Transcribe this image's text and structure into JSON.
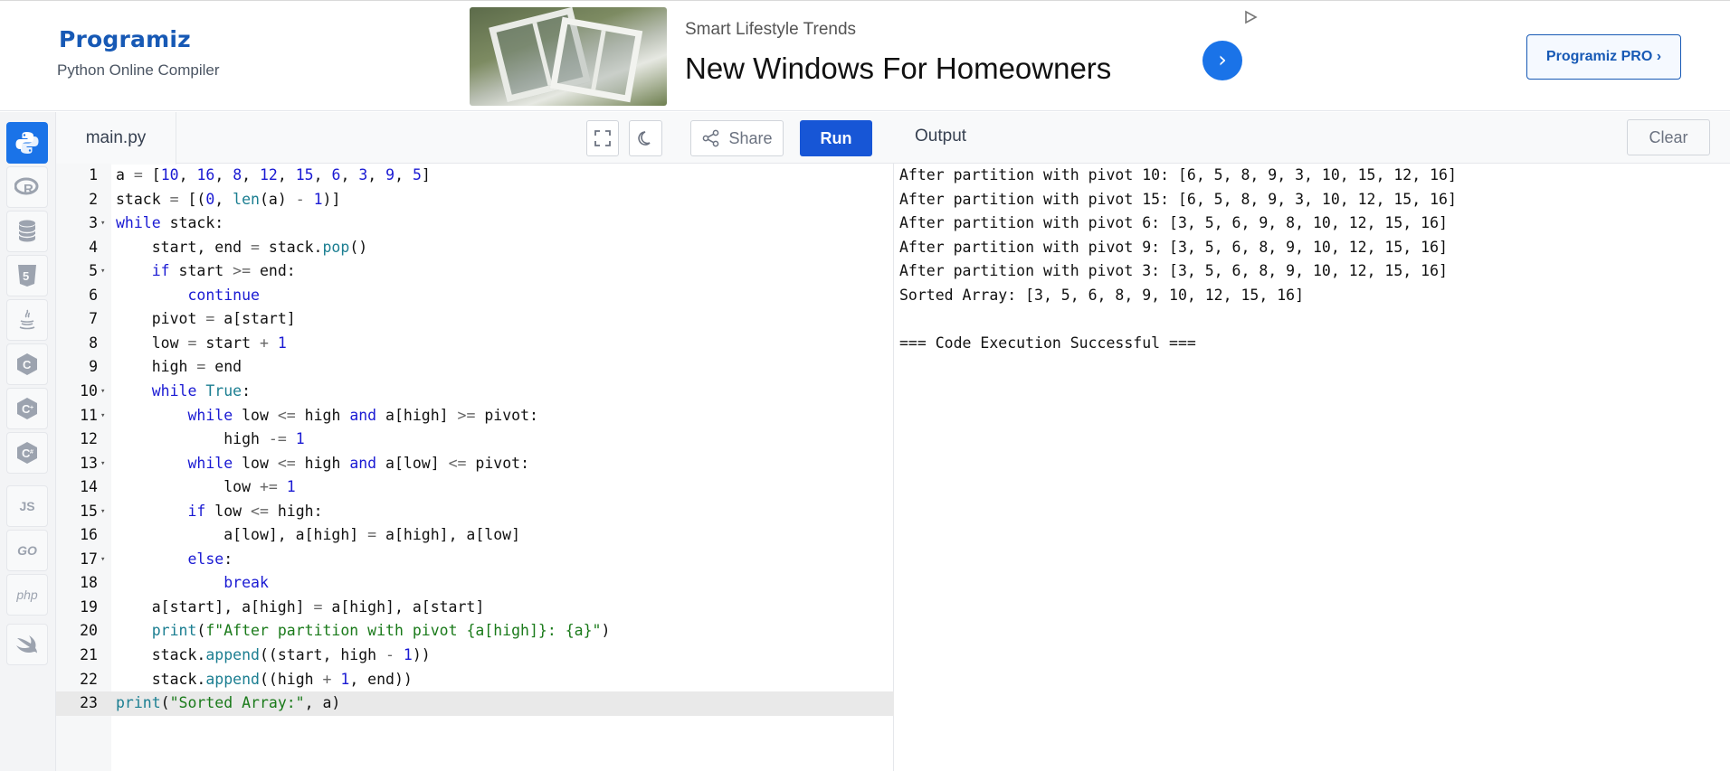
{
  "header": {
    "logo_text": "Programiz",
    "subtitle": "Python Online Compiler",
    "pro_button": "Programiz PRO ›"
  },
  "ad": {
    "brand": "Smart Lifestyle Trends",
    "title": "New Windows For Homeowners",
    "go_icon": "chevron-right-icon",
    "choice_icon": "ad-choices-icon"
  },
  "language_rail": {
    "items": [
      {
        "name": "python",
        "icon": "python-icon",
        "active": true
      },
      {
        "name": "r",
        "icon": "r-icon",
        "active": false
      },
      {
        "name": "sql",
        "icon": "database-icon",
        "active": false
      },
      {
        "name": "html",
        "icon": "html5-icon",
        "active": false
      },
      {
        "name": "java",
        "icon": "java-icon",
        "active": false
      },
      {
        "name": "c",
        "icon": "c-icon",
        "active": false
      },
      {
        "name": "cpp",
        "icon": "cpp-icon",
        "active": false
      },
      {
        "name": "csharp",
        "icon": "csharp-icon",
        "active": false
      },
      {
        "name": "js",
        "label": "JS",
        "active": false
      },
      {
        "name": "go",
        "label": "GO",
        "active": false
      },
      {
        "name": "php",
        "label": "php",
        "active": false
      },
      {
        "name": "swift",
        "icon": "swift-icon",
        "active": false
      }
    ]
  },
  "editor": {
    "file_tab": "main.py",
    "share_label": "Share",
    "run_label": "Run",
    "active_line": 23,
    "lines": [
      "a = [10, 16, 8, 12, 15, 6, 3, 9, 5]",
      "stack = [(0, len(a) - 1)]",
      "while stack:",
      "    start, end = stack.pop()",
      "    if start >= end:",
      "        continue",
      "    pivot = a[start]",
      "    low = start + 1",
      "    high = end",
      "    while True:",
      "        while low <= high and a[high] >= pivot:",
      "            high -= 1",
      "        while low <= high and a[low] <= pivot:",
      "            low += 1",
      "        if low <= high:",
      "            a[low], a[high] = a[high], a[low]",
      "        else:",
      "            break",
      "    a[start], a[high] = a[high], a[start]",
      "    print(f\"After partition with pivot {a[high]}: {a}\")",
      "    stack.append((start, high - 1))",
      "    stack.append((high + 1, end))",
      "print(\"Sorted Array:\", a)"
    ],
    "fold_lines": [
      3,
      5,
      10,
      11,
      13,
      15,
      17
    ]
  },
  "output": {
    "title": "Output",
    "clear_label": "Clear",
    "lines": [
      "After partition with pivot 10: [6, 5, 8, 9, 3, 10, 15, 12, 16]",
      "After partition with pivot 15: [6, 5, 8, 9, 3, 10, 12, 15, 16]",
      "After partition with pivot 6: [3, 5, 6, 9, 8, 10, 12, 15, 16]",
      "After partition with pivot 9: [3, 5, 6, 8, 9, 10, 12, 15, 16]",
      "After partition with pivot 3: [3, 5, 6, 8, 9, 10, 12, 15, 16]",
      "Sorted Array: [3, 5, 6, 8, 9, 10, 12, 15, 16]",
      "",
      "=== Code Execution Successful ==="
    ]
  },
  "colors": {
    "brand": "#1759b5",
    "run": "#1756d6",
    "accent": "#1a73e8",
    "keyword": "#1a1ad3",
    "string": "#1a7a1a"
  }
}
